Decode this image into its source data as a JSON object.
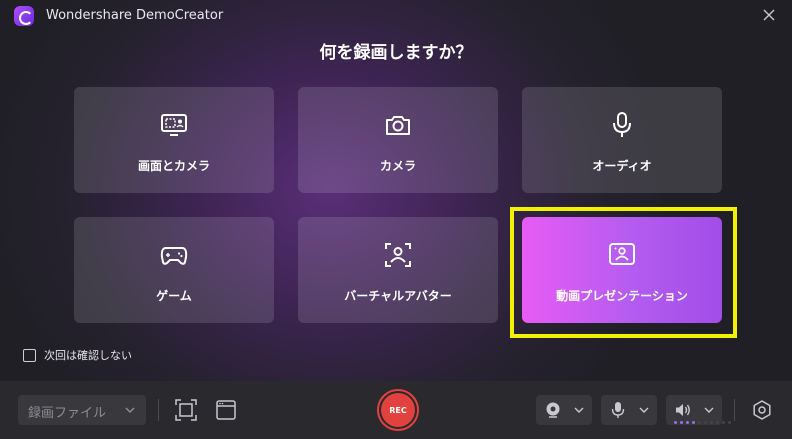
{
  "app": {
    "title": "Wondershare DemoCreator"
  },
  "prompt": {
    "question": "何を録画しますか？"
  },
  "modes": [
    {
      "label": "画面とカメラ",
      "icon": "screen-camera-icon",
      "selected": false
    },
    {
      "label": "カメラ",
      "icon": "camera-icon",
      "selected": false
    },
    {
      "label": "オーディオ",
      "icon": "microphone-icon",
      "selected": false
    },
    {
      "label": "ゲーム",
      "icon": "gamepad-icon",
      "selected": false
    },
    {
      "label": "バーチャルアバター",
      "icon": "avatar-icon",
      "selected": false
    },
    {
      "label": "動画プレゼンテーション",
      "icon": "presentation-icon",
      "selected": true
    }
  ],
  "options": {
    "dont_ask_label": "次回は確認しない",
    "dont_ask_checked": false
  },
  "toolbar": {
    "file_select_label": "録画ファイル",
    "rec_label": "REC",
    "audio_level_fraction": 0.4
  },
  "colors": {
    "accent_start": "#e75cf5",
    "accent_end": "#a14de8",
    "rec": "#e2423d",
    "highlight": "#f2f200"
  }
}
